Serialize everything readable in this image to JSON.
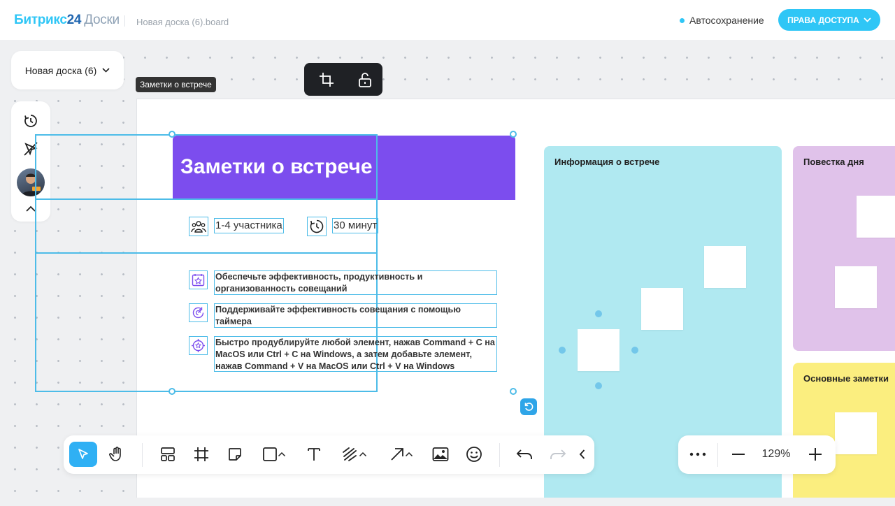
{
  "app": {
    "logo_brand": "Битрикс",
    "logo_num": "24",
    "logo_product": "Доски",
    "file_name": "Новая доска (6).board",
    "autosave": "Автосохранение",
    "access_button": "ПРАВА ДОСТУПА"
  },
  "board_selector": {
    "label": "Новая доска (6)"
  },
  "left_tools": [
    "timer-icon",
    "no-pointer-icon",
    "avatar",
    "collapse-icon"
  ],
  "frame": {
    "tooltip": "Заметки о встрече"
  },
  "card": {
    "title": "Заметки о встрече",
    "participants": "1-4 участника",
    "duration": "30 минут",
    "bullets": [
      "Обеспечьте эффективность, продуктивность и организованность совещаний",
      "Поддерживайте эффективность совещания с помощью таймера",
      "Быстро продублируйте любой элемент, нажав Command + C на MacOS или Ctrl + C на Windows, а затем добавьте элемент, нажав Command + V на  MacOS или Ctrl + V на Windows"
    ]
  },
  "columns": {
    "info": "Информация о встрече",
    "agenda": "Повестка дня",
    "notes": "Основные заметки"
  },
  "colors": {
    "accent": "#2fc6f6",
    "card_header": "#7c4dee",
    "info_column": "#b0e9f1",
    "agenda_column": "#e0c2ea",
    "notes_column": "#fbee7f",
    "selection": "#4dbce8"
  },
  "zoom": {
    "value": "129%"
  },
  "bottom_toolbar": [
    "select-icon",
    "hand-icon",
    "template-icon",
    "frame-icon",
    "sticky-icon",
    "shape-icon",
    "text-icon",
    "pen-icon",
    "arrow-icon",
    "image-icon",
    "emoji-icon",
    "undo-icon",
    "redo-icon",
    "collapse-icon"
  ]
}
